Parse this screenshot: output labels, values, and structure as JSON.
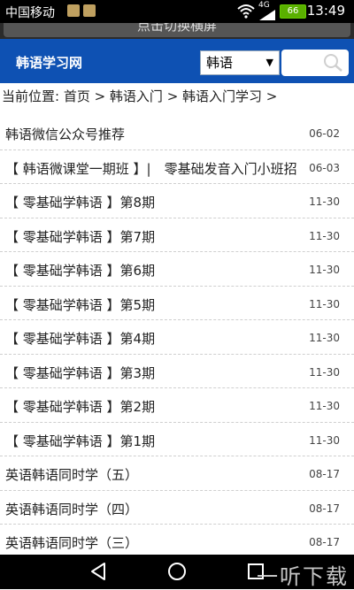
{
  "status": {
    "carrier": "中国移动",
    "network": "4G",
    "battery": "66",
    "time": "13:49"
  },
  "rotate_button": "点击切换横屏",
  "header": {
    "logo": "韩语学习网",
    "select_value": "韩语"
  },
  "breadcrumb": "当前位置: 首页 > 韩语入门 > 韩语入门学习 >",
  "articles": [
    {
      "title": "韩语微信公众号推荐",
      "date": "06-02"
    },
    {
      "title": "【 韩语微课堂一期班 】|　零基础发音入门小班招",
      "date": "06-03"
    },
    {
      "title": "【 零基础学韩语 】第8期",
      "date": "11-30"
    },
    {
      "title": "【 零基础学韩语 】第7期",
      "date": "11-30"
    },
    {
      "title": "【 零基础学韩语 】第6期",
      "date": "11-30"
    },
    {
      "title": "【 零基础学韩语 】第5期",
      "date": "11-30"
    },
    {
      "title": "【 零基础学韩语 】第4期",
      "date": "11-30"
    },
    {
      "title": "【 零基础学韩语 】第3期",
      "date": "11-30"
    },
    {
      "title": "【 零基础学韩语 】第2期",
      "date": "11-30"
    },
    {
      "title": "【 零基础学韩语 】第1期",
      "date": "11-30"
    },
    {
      "title": "英语韩语同时学（五）",
      "date": "08-17"
    },
    {
      "title": "英语韩语同时学（四）",
      "date": "08-17"
    },
    {
      "title": "英语韩语同时学（三）",
      "date": "08-17"
    }
  ],
  "watermark": "一听下载",
  "icons": {
    "back": "back-icon",
    "home": "home-icon",
    "recent": "recent-apps-icon",
    "search": "search-icon"
  }
}
